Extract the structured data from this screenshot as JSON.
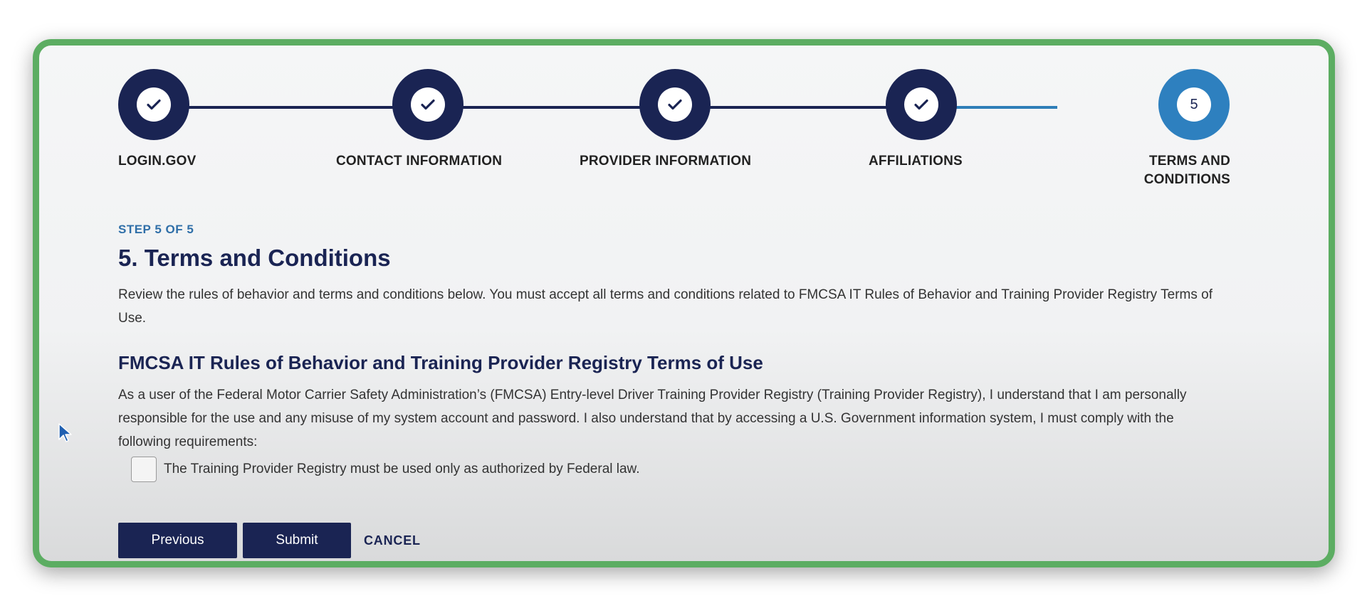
{
  "steps": [
    {
      "label": "LOGIN.GOV",
      "status": "complete",
      "icon": "check-icon"
    },
    {
      "label": "CONTACT INFORMATION",
      "status": "complete",
      "icon": "check-icon"
    },
    {
      "label": "PROVIDER INFORMATION",
      "status": "complete",
      "icon": "check-icon"
    },
    {
      "label": "AFFILIATIONS",
      "status": "complete",
      "icon": "check-icon"
    },
    {
      "label_line1": "TERMS AND",
      "label_line2": "CONDITIONS",
      "number": "5",
      "status": "current"
    }
  ],
  "main": {
    "step_indicator": "STEP 5 OF 5",
    "title": "5. Terms and Conditions",
    "description": "Review the rules of behavior and terms and conditions below. You must accept all terms and conditions related to FMCSA IT Rules of Behavior and Training Provider Registry Terms of Use.",
    "section_title": "FMCSA IT Rules of Behavior and Training Provider Registry Terms of Use",
    "section_body": "As a user of the Federal Motor Carrier Safety Administration’s (FMCSA) Entry-level Driver Training Provider Registry (Training Provider Registry), I understand that I am personally responsible for the use and any misuse of my system account and password. I also understand that by accessing a U.S. Government information system, I must comply with the following requirements:",
    "requirements": [
      {
        "label": "The Training Provider Registry must be used only as authorized by Federal law.",
        "checked": false
      }
    ]
  },
  "actions": {
    "previous": "Previous",
    "submit": "Submit",
    "cancel": "CANCEL"
  },
  "colors": {
    "navy": "#1a2453",
    "active_step": "#2e80bf",
    "step_text": "#2f6fa8",
    "frame_border": "#5cad62"
  }
}
